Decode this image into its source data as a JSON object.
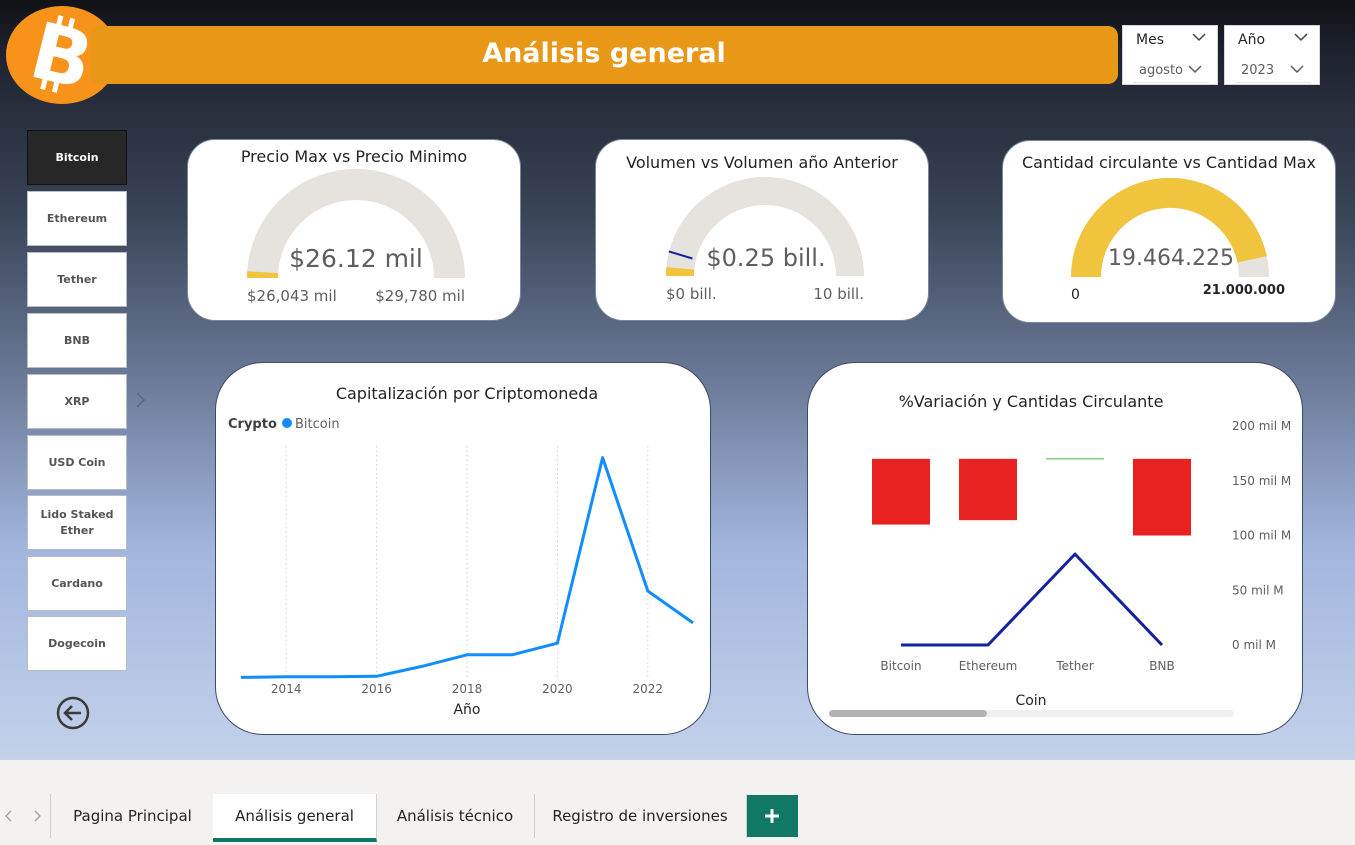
{
  "header": {
    "title": "Análisis general"
  },
  "logo": {
    "icon": "bitcoin-icon",
    "color": "#f7931a"
  },
  "filters": {
    "month": {
      "label": "Mes",
      "value": "agosto"
    },
    "year": {
      "label": "Año",
      "value": "2023"
    }
  },
  "coins": [
    "Bitcoin",
    "Ethereum",
    "Tether",
    "BNB",
    "XRP",
    "USD Coin",
    "Lido Staked Ether",
    "Cardano",
    "Dogecoin"
  ],
  "gauges": {
    "price": {
      "title": "Precio Max vs Precio Minimo",
      "value": "$26.12 mil",
      "min": "$26,043 mil",
      "max": "$29,780 mil",
      "fill_fraction": 0.02
    },
    "volume": {
      "title": "Volumen vs Volumen año Anterior",
      "value": "$0.25 bill.",
      "min": "$0 bill.",
      "max": "10 bill.",
      "fill_fraction": 0.025,
      "target_fraction": 0.1
    },
    "supply": {
      "title": "Cantidad circulante vs Cantidad Max",
      "value": "19.464.225",
      "min": "0",
      "max": "21.000.000",
      "fill_fraction": 0.927
    }
  },
  "chart_cap": {
    "title": "Capitalización por Criptomoneda",
    "legend_title": "Crypto",
    "xlabel": "Año",
    "xticks": [
      "2014",
      "2016",
      "2018",
      "2020",
      "2022"
    ]
  },
  "chart_var": {
    "title": "%Variación y Cantidas Circulante",
    "xlabel": "Coin",
    "yticks": [
      "200 mil M",
      "150 mil M",
      "100 mil M",
      "50 mil M",
      "0 mil M"
    ]
  },
  "chart_data": [
    {
      "type": "line",
      "title": "Capitalización por Criptomoneda",
      "xlabel": "Año",
      "legend": [
        "Bitcoin"
      ],
      "x": [
        2013,
        2014,
        2015,
        2016,
        2017,
        2018,
        2019,
        2020,
        2021,
        2022,
        2023
      ],
      "series": [
        {
          "name": "Bitcoin",
          "values": [
            1,
            2,
            2,
            3,
            20,
            40,
            40,
            60,
            380,
            150,
            95
          ]
        }
      ],
      "ylim": [
        0,
        400
      ],
      "color": "#118dff"
    },
    {
      "type": "bar",
      "title": "%Variación y Cantidas Circulante",
      "xlabel": "Coin",
      "categories": [
        "Bitcoin",
        "Ethereum",
        "Tether",
        "BNB"
      ],
      "series": [
        {
          "type": "waterfall",
          "color": "#e82121",
          "ranges": [
            [
              110,
              170
            ],
            [
              114,
              170
            ],
            [
              170,
              170
            ],
            [
              100,
              170
            ]
          ]
        },
        {
          "type": "line",
          "color": "#12239e",
          "values": [
            0,
            0,
            83,
            0
          ]
        }
      ],
      "ylim": [
        0,
        200
      ]
    }
  ],
  "tabs": [
    "Pagina Principal",
    "Análisis general",
    "Análisis técnico",
    "Registro de inversiones"
  ],
  "active_tab": "Análisis general",
  "colors": {
    "accent": "#e89717",
    "gauge_fill": "#f0c43c",
    "gauge_track": "#e6e2de",
    "line": "#118dff",
    "bar": "#e82121",
    "navy": "#12239e",
    "tab_active": "#117865"
  }
}
